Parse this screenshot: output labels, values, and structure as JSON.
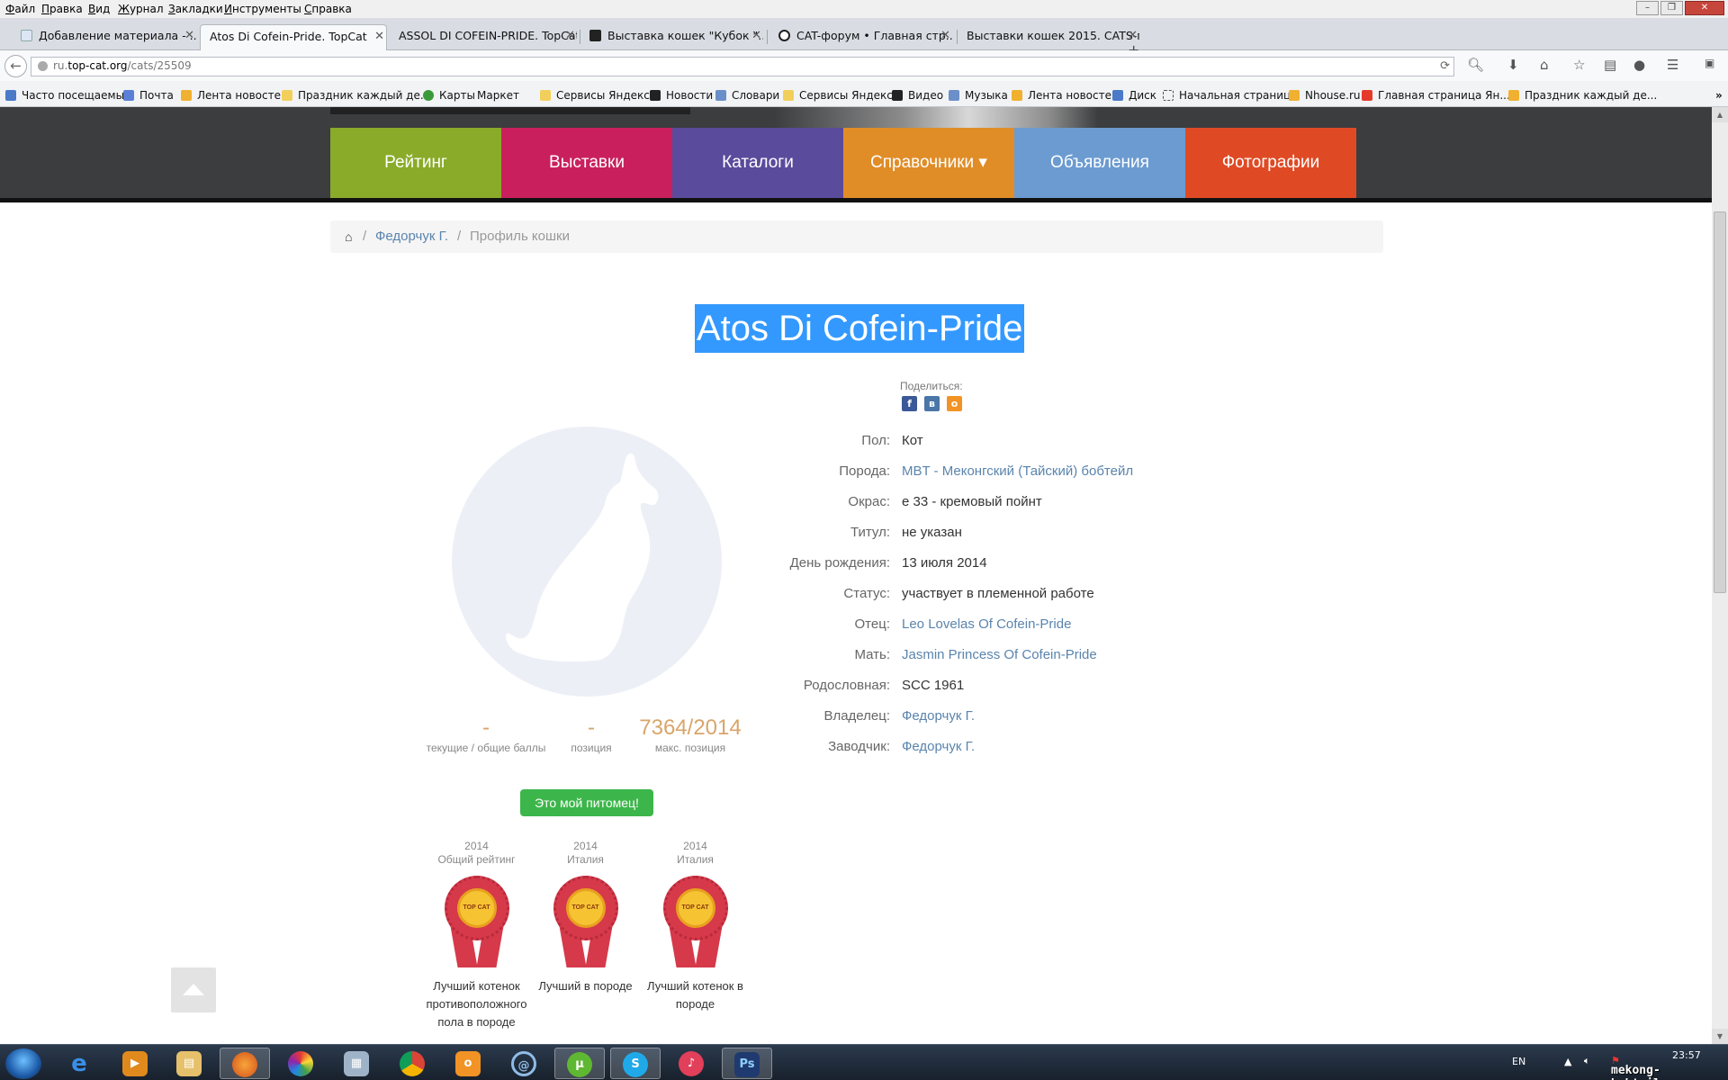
{
  "menubar": {
    "items": [
      "Файл",
      "Правка",
      "Вид",
      "Журнал",
      "Закладки",
      "Инструменты",
      "Справка"
    ]
  },
  "tabs": [
    {
      "title": "Добавление материала - ..."
    },
    {
      "title": "Atos Di Cofein-Pride. TopCat"
    },
    {
      "title": "ASSOL DI COFEIN-PRIDE. TopCat"
    },
    {
      "title": "Выставка кошек \"Кубок \"..."
    },
    {
      "title": "CAT-форум • Главная стр..."
    },
    {
      "title": "Выставки кошек 2015. CATS-п..."
    }
  ],
  "address": {
    "url_prefix": "ru.",
    "url_domain": "top-cat.org",
    "url_path": "/cats/25509"
  },
  "bookmarks": [
    "Часто посещаемые",
    "Почта",
    "Лента новостей",
    "Праздник каждый де...",
    "Карты",
    "Маркет",
    "Сервисы Яндекса",
    "Новости",
    "Словари",
    "Сервисы Яндекса",
    "Видео",
    "Музыка",
    "Лента новостей",
    "Диск",
    "Начальная страница",
    "Nhouse.ru",
    "Главная страница Ян...",
    "Праздник каждый де..."
  ],
  "nav": {
    "items": [
      "Рейтинг",
      "Выставки",
      "Каталоги",
      "Справочники ▾",
      "Объявления",
      "Фотографии"
    ],
    "colors": [
      "#8aab29",
      "#c9205d",
      "#5a4b9c",
      "#e08d28",
      "#6b9bd1",
      "#df4a25"
    ]
  },
  "breadcrumb": {
    "owner": "Федорчук Г.",
    "current": "Профиль кошки",
    "separator": "/"
  },
  "cat": {
    "name": "Atos Di Cofein-Pride",
    "share_label": "Поделиться:",
    "fields": [
      {
        "label": "Пол:",
        "value": "Кот"
      },
      {
        "label": "Порода:",
        "value": "MBT - Меконгский (Тайский) бобтейл"
      },
      {
        "label": "Окрас:",
        "value": "e 33 - кремовый пойнт"
      },
      {
        "label": "Титул:",
        "value": "не указан"
      },
      {
        "label": "День рождения:",
        "value": "13 июля 2014"
      },
      {
        "label": "Статус:",
        "value": "участвует в племенной работе"
      },
      {
        "label": "Отец:",
        "value": "Leo Lovelas Of Cofein-Pride"
      },
      {
        "label": "Мать:",
        "value": "Jasmin Princess Of Cofein-Pride"
      },
      {
        "label": "Родословная:",
        "value": "SCC 1961"
      },
      {
        "label": "Владелец:",
        "value": "Федорчук Г."
      },
      {
        "label": "Заводчик:",
        "value": "Федорчук Г."
      }
    ]
  },
  "stats": [
    {
      "value": "-",
      "label": "текущие / общие баллы"
    },
    {
      "value": "-",
      "label": "позиция"
    },
    {
      "value": "7364/2014",
      "label": "макс. позиция"
    }
  ],
  "pet_button": "Это мой питомец!",
  "awards": [
    {
      "year": "2014",
      "category": "Общий рейтинг",
      "name": "Лучший котенок противоположного пола в породе"
    },
    {
      "year": "2014",
      "category": "Италия",
      "name": "Лучший в породе"
    },
    {
      "year": "2014",
      "category": "Италия",
      "name": "Лучший котенок в породе"
    }
  ],
  "award_logo_text": "TOP CAT",
  "taskbar": {
    "lang": "EN",
    "time": "23:57"
  },
  "watermark": "mekong-bobtail.ru"
}
